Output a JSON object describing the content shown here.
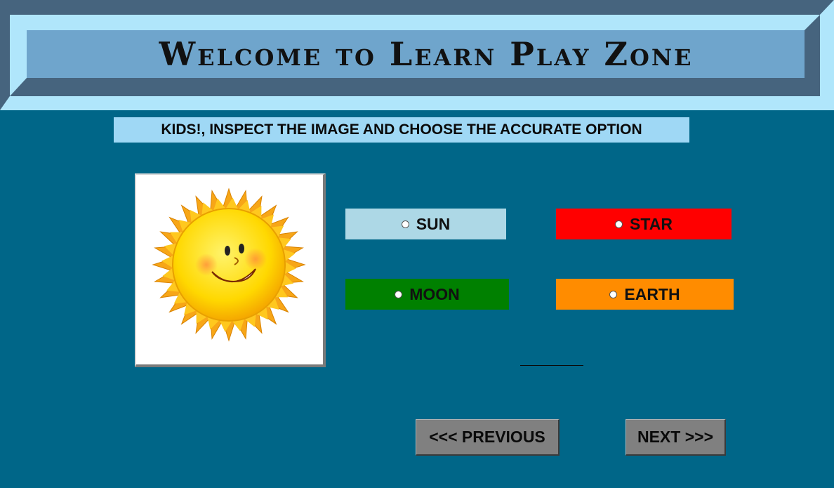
{
  "header": {
    "title": "Welcome to Learn Play Zone"
  },
  "instruction": "KIDS!, INSPECT THE IMAGE AND CHOOSE THE ACCURATE OPTION",
  "picture": {
    "icon": "sun-icon"
  },
  "options": [
    {
      "label": "SUN",
      "color": "#add8e6"
    },
    {
      "label": "STAR",
      "color": "#ff0000"
    },
    {
      "label": "MOON",
      "color": "#008000"
    },
    {
      "label": "EARTH",
      "color": "#ff8c00"
    }
  ],
  "navigation": {
    "previous_label": "<<< PREVIOUS",
    "next_label": "NEXT >>>"
  },
  "colors": {
    "background": "#006688",
    "banner_plate": "#6fa5cc",
    "instruction_bg": "#9fd8f5",
    "button_gray": "#808080"
  }
}
